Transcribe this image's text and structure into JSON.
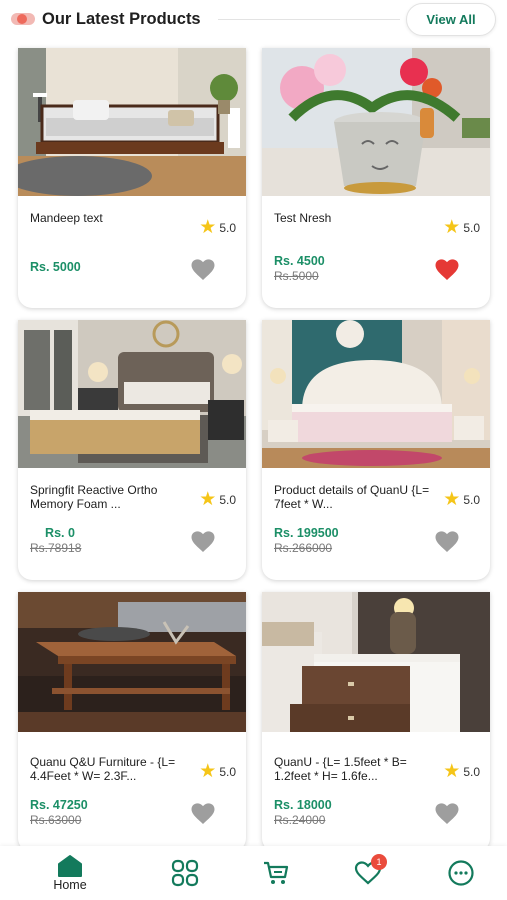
{
  "header": {
    "title": "Our Latest Products",
    "view_all": "View All"
  },
  "products": [
    {
      "name": "Mandeep text",
      "rating": "5.0",
      "price": "Rs. 5000",
      "old_price": "",
      "favorite": false
    },
    {
      "name": "Test Nresh",
      "rating": "5.0",
      "price": "Rs. 4500",
      "old_price": "Rs.5000",
      "favorite": true
    },
    {
      "name": "Springfit Reactive Ortho Memory Foam ...",
      "rating": "5.0",
      "price": "Rs. 0",
      "old_price": "Rs.78918",
      "favorite": false
    },
    {
      "name": "Product details of QuanU {L= 7feet * W...",
      "rating": "5.0",
      "price": "Rs. 199500",
      "old_price": "Rs.266000",
      "favorite": false
    },
    {
      "name": "Quanu Q&U Furniture - {L= 4.4Feet * W= 2.3F...",
      "rating": "5.0",
      "price": "Rs. 47250",
      "old_price": "Rs.63000",
      "favorite": false
    },
    {
      "name": "QuanU - {L= 1.5feet * B= 1.2feet * H= 1.6fe...",
      "rating": "5.0",
      "price": "Rs. 18000",
      "old_price": "Rs.24000",
      "favorite": false
    }
  ],
  "nav": {
    "home_label": "Home",
    "wishlist_badge": "1"
  },
  "colors": {
    "accent": "#137a5c",
    "price": "#1c8f67",
    "heart_active": "#e53935",
    "heart_inactive": "#9e9e9e",
    "star": "#f5c518"
  }
}
